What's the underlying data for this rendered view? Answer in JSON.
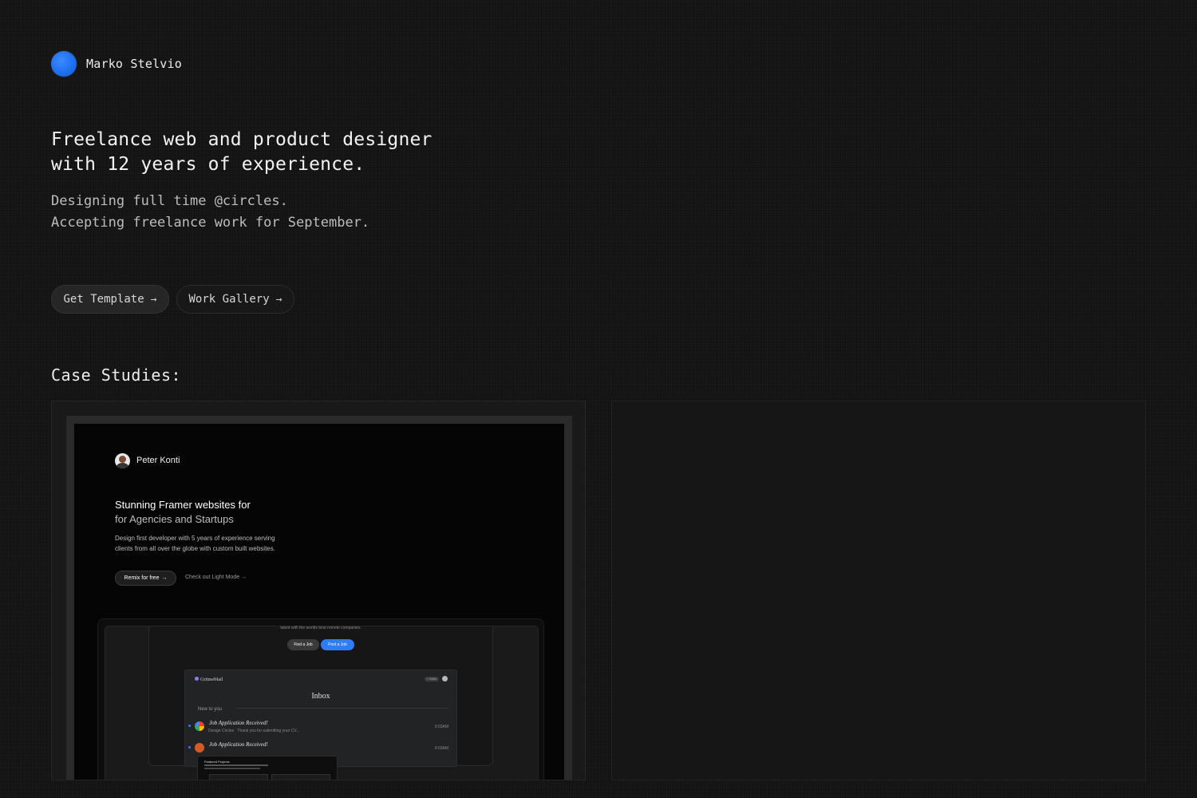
{
  "profile": {
    "name": "Marko Stelvio",
    "avatar_color": "#1f6ff2"
  },
  "hero": {
    "headline_line1": "Freelance web and product designer",
    "headline_line2": "with 12 years of experience.",
    "sub_line1": "Designing full time @circles.",
    "sub_line2": "Accepting freelance work for September."
  },
  "actions": {
    "template_label": "Get Template",
    "gallery_label": "Work Gallery",
    "arrow": "→"
  },
  "case_studies": {
    "title": "Case Studies:",
    "preview": {
      "name": "Peter Konti",
      "headline_line1": "Stunning Framer websites for",
      "headline_line2": "for Agencies and Startups",
      "desc_line1": "Design first developer with 5 years of experience serving",
      "desc_line2": "clients from all over the globe with custom built websites.",
      "primary_cta": "Remix for free",
      "secondary_cta": "Check out Light Mode",
      "arrow": "→",
      "tablet": {
        "talent_text": "talent with the worlds best remote companies.",
        "find_job": "Find a Job",
        "post_job": "Post a Job",
        "mail": {
          "logo": "GritmeMail",
          "write": "+ Write",
          "inbox": "Inbox",
          "new_label": "New to you",
          "rows": [
            {
              "subject": "Job Application Received!",
              "from": "Design Circles",
              "snippet": "Thank you for submitting your CV...",
              "time": "9:03AM"
            },
            {
              "subject": "Job Application Received!",
              "from": "",
              "snippet": "",
              "time": "9:03AM"
            }
          ]
        },
        "featured_label": "Featured Projects"
      }
    }
  },
  "colors": {
    "background": "#141414",
    "accent": "#2f7cf6"
  }
}
